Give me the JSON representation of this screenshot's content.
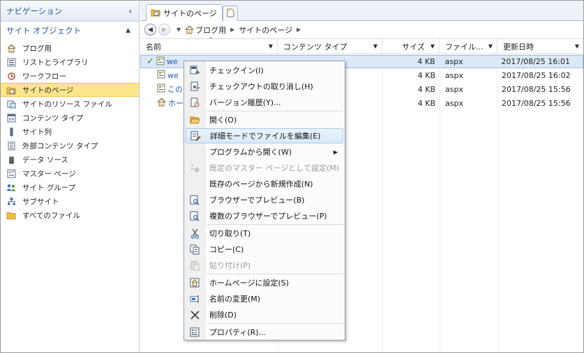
{
  "nav": {
    "header": "ナビゲーション",
    "section": "サイト オブジェクト",
    "items": [
      {
        "label": "ブログ用",
        "icon": "home-icon"
      },
      {
        "label": "リストとライブラリ",
        "icon": "list-icon"
      },
      {
        "label": "ワークフロー",
        "icon": "workflow-icon"
      },
      {
        "label": "サイトのページ",
        "icon": "site-pages-icon",
        "selected": true
      },
      {
        "label": "サイトのリソース ファイル",
        "icon": "resource-file-icon"
      },
      {
        "label": "コンテンツ タイプ",
        "icon": "content-type-icon"
      },
      {
        "label": "サイト列",
        "icon": "site-column-icon"
      },
      {
        "label": "外部コンテンツ タイプ",
        "icon": "external-content-icon"
      },
      {
        "label": "データ ソース",
        "icon": "data-source-icon"
      },
      {
        "label": "マスター ページ",
        "icon": "master-page-icon"
      },
      {
        "label": "サイト グループ",
        "icon": "site-group-icon"
      },
      {
        "label": "サブサイト",
        "icon": "subsite-icon"
      },
      {
        "label": "すべてのファイル",
        "icon": "folder-icon"
      }
    ]
  },
  "tab": {
    "label": "サイトのページ"
  },
  "breadcrumb": {
    "items": [
      "ブログ用",
      "サイトのページ"
    ]
  },
  "columns": {
    "name": "名前",
    "type": "コンテンツ タイプ",
    "size": "サイズ",
    "ext": "ファイル...",
    "date": "更新日時"
  },
  "rows": [
    {
      "name": "we",
      "size": "4 KB",
      "ext": "aspx",
      "date": "2017/08/25 16:01",
      "checked": true
    },
    {
      "name": "we",
      "size": "4 KB",
      "ext": "aspx",
      "date": "2017/08/25 16:02"
    },
    {
      "name": "この",
      "size": "4 KB",
      "ext": "aspx",
      "date": "2017/08/25 15:56"
    },
    {
      "name": "ホー",
      "size": "4 KB",
      "ext": "aspx",
      "date": "2017/08/25 15:56"
    }
  ],
  "context_menu": {
    "checkin": "チェックイン(I)",
    "undo_checkout": "チェックアウトの取り消し(H)",
    "version_history": "バージョン履歴(Y)...",
    "open": "開く(O)",
    "edit_advanced": "詳細モードでファイルを編集(E)",
    "open_with": "プログラムから開く(W)",
    "set_master": "既定のマスター ページとして設定(M)",
    "new_from_existing": "既存のページから新規作成(N)",
    "preview": "ブラウザーでプレビュー(B)",
    "preview_multi": "複数のブラウザーでプレビュー(P)",
    "cut": "切り取り(T)",
    "copy": "コピー(C)",
    "paste": "貼り付け(P)",
    "set_home": "ホームページに設定(S)",
    "rename": "名前の変更(M)",
    "delete": "削除(D)",
    "properties": "プロパティ(R)..."
  },
  "colors": {
    "selected_nav": "#fde58a",
    "link_blue": "#1f5aa6",
    "menu_highlight": "#d9e9f9"
  }
}
